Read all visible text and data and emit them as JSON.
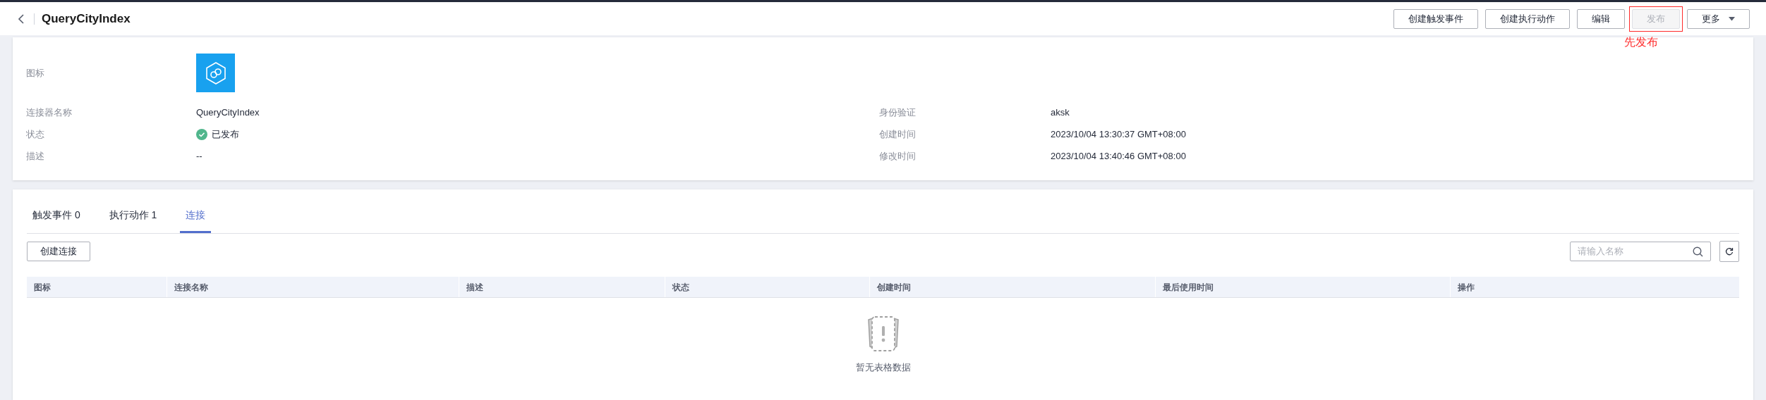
{
  "header": {
    "title": "QueryCityIndex",
    "buttons": [
      {
        "label": "创建触发事件",
        "disabled": false,
        "highlighted": false,
        "dropdown": false
      },
      {
        "label": "创建执行动作",
        "disabled": false,
        "highlighted": false,
        "dropdown": false
      },
      {
        "label": "编辑",
        "disabled": false,
        "highlighted": false,
        "dropdown": false
      },
      {
        "label": "发布",
        "disabled": true,
        "highlighted": true,
        "dropdown": false
      },
      {
        "label": "更多",
        "disabled": false,
        "highlighted": false,
        "dropdown": true
      }
    ],
    "annotation": "先发布"
  },
  "details": {
    "icon_label": "图标",
    "left": [
      {
        "label": "连接器名称",
        "value": "QueryCityIndex",
        "kind": "text"
      },
      {
        "label": "状态",
        "value": "已发布",
        "kind": "status"
      },
      {
        "label": "描述",
        "value": "--",
        "kind": "text"
      }
    ],
    "right": [
      {
        "label": "身份验证",
        "value": "aksk"
      },
      {
        "label": "创建时间",
        "value": "2023/10/04 13:30:37 GMT+08:00"
      },
      {
        "label": "修改时间",
        "value": "2023/10/04 13:40:46 GMT+08:00"
      }
    ]
  },
  "tabs": [
    {
      "label": "触发事件 0",
      "selected": false
    },
    {
      "label": "执行动作 1",
      "selected": false
    },
    {
      "label": "连接",
      "selected": true
    }
  ],
  "toolbar": {
    "create_button": "创建连接",
    "search": {
      "placeholder": "请输入名称"
    }
  },
  "table": {
    "columns": [
      "图标",
      "连接名称",
      "描述",
      "状态",
      "创建时间",
      "最后使用时间",
      "操作"
    ],
    "empty_text": "暂无表格数据"
  }
}
